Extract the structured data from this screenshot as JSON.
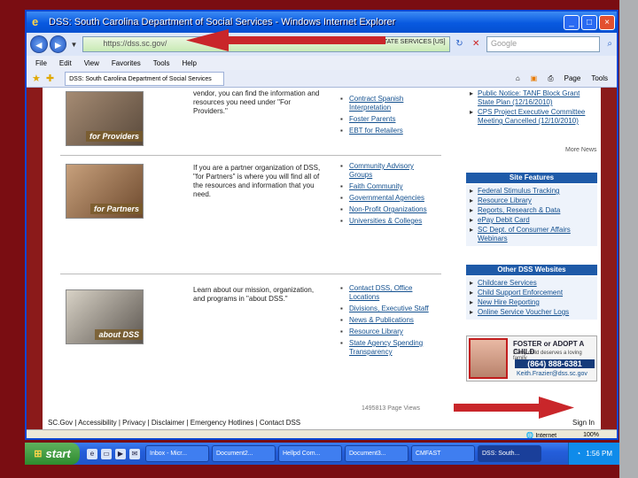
{
  "colors": {
    "slide_bg": "#7a0d12",
    "arrow": "#c9262a",
    "ie_title": "#0859e0",
    "site_box": "#1e5aa8",
    "link": "#13508f"
  },
  "window": {
    "title": "DSS: South Carolina Department of Social Services - Windows Internet Explorer",
    "icon": "ie-icon",
    "url": "https://dss.sc.gov/",
    "cert": "STATE SERVICES [US]",
    "search_placeholder": "Google",
    "menu": [
      "File",
      "Edit",
      "View",
      "Favorites",
      "Tools",
      "Help"
    ],
    "tab": "DSS: South Carolina Department of Social Services",
    "tools": [
      "Page",
      "Tools"
    ]
  },
  "rows": [
    {
      "caption": "for Providers",
      "text": "vendor, you can find the information and resources you need under \"For Providers.\"",
      "links": [
        "Contract Spanish Interpretation",
        "Foster Parents",
        "EBT for Retailers"
      ]
    },
    {
      "caption": "for Partners",
      "text": "If you are a partner organization of DSS, \"for Partners\" is where you will find all of the resources and information that you need.",
      "links": [
        "Community Advisory Groups",
        "Faith Community",
        "Governmental Agencies",
        "Non-Profit Organizations",
        "Universities & Colleges"
      ]
    },
    {
      "caption": "about DSS",
      "text": "Learn about our mission, organization, and programs in \"about DSS.\"",
      "links": [
        "Contact DSS, Office Locations",
        "Divisions, Executive Staff",
        "News & Publications",
        "Resource Library",
        "State Agency Spending Transparency"
      ]
    }
  ],
  "news": [
    "Public Notice: TANF Block Grant State Plan (12/16/2010)",
    "CPS Project Executive Committee Meeting Cancelled (12/10/2010)"
  ],
  "more_news": "More News",
  "site_features": {
    "title": "Site Features",
    "items": [
      "Federal Stimulus Tracking",
      "Resource Library",
      "Reports, Research & Data",
      "ePay Debit Card",
      "SC Dept. of Consumer Affairs Webinars"
    ]
  },
  "other_sites": {
    "title": "Other DSS Websites",
    "items": [
      "Childcare Services",
      "Child Support Enforcement",
      "New Hire Reporting",
      "Online Service Voucher Logs"
    ]
  },
  "foster_ad": {
    "title": "FOSTER or ADOPT A CHILD",
    "sub": "Every child deserves a loving family",
    "phone": "(864) 888-6381",
    "email": "Keith.Frazier@dss.sc.gov"
  },
  "page_views": "1495813 Page Views",
  "footer": "SC.Gov | Accessibility | Privacy | Disclaimer | Emergency Hotlines | Contact DSS",
  "signin": "Sign In",
  "status": {
    "zone": "Internet",
    "zoom": "100%"
  },
  "taskbar": {
    "start": "start",
    "tasks": [
      "Inbox - Micr...",
      "Document2...",
      "Hellpd Com...",
      "Document3...",
      "CMFAST",
      "DSS: South..."
    ],
    "clock": "1:56 PM"
  }
}
